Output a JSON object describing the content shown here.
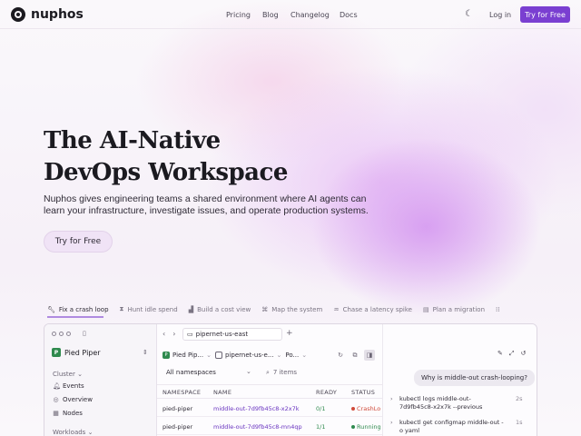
{
  "brand": {
    "name": "nuphos"
  },
  "nav": {
    "links": [
      "Pricing",
      "Blog",
      "Changelog",
      "Docs"
    ],
    "theme_icon": "moon-icon",
    "login": "Log in",
    "cta": "Try for Free"
  },
  "colors": {
    "accent": "#7a3fd1",
    "pod_link": "#6a35c0",
    "ready_green": "#2f8a4e",
    "crash_red": "#d04a3a"
  },
  "hero": {
    "title_line1": "The AI-Native",
    "title_line2": "DevOps Workspace",
    "subtitle": "Nuphos gives engineering teams a shared environment where AI agents can learn your infrastructure, investigate issues, and operate production systems.",
    "cta": "Try for Free"
  },
  "tabs": [
    {
      "label": "Fix a crash loop",
      "icon": "wrench-icon",
      "active": true
    },
    {
      "label": "Hunt idle spend",
      "icon": "hourglass-icon"
    },
    {
      "label": "Build a cost view",
      "icon": "chart-icon"
    },
    {
      "label": "Map the system",
      "icon": "map-icon"
    },
    {
      "label": "Chase a latency spike",
      "icon": "pulse-icon"
    },
    {
      "label": "Plan a migration",
      "icon": "clipboard-icon"
    }
  ],
  "app": {
    "sidebar": {
      "org": "Pied Piper",
      "org_badge": "P",
      "section_cluster": "Cluster",
      "items": [
        {
          "label": "Events",
          "icon": "bell-icon"
        },
        {
          "label": "Overview",
          "icon": "gauge-icon"
        },
        {
          "label": "Nodes",
          "icon": "server-icon"
        }
      ],
      "section_workloads": "Workloads"
    },
    "browser_tab": "pipernet-us-east",
    "crumbs": [
      "Pied Pip...",
      "pipernet-us-e...",
      "Po..."
    ],
    "filter": "All namespaces",
    "search": "7 items",
    "table": {
      "headers": [
        "NAMESPACE",
        "NAME",
        "READY",
        "STATUS"
      ],
      "rows": [
        {
          "namespace": "pied-piper",
          "name": "middle-out-7d9fb45c8-x2x7k",
          "ready": "0/1",
          "status": "CrashLo"
        },
        {
          "namespace": "pied-piper",
          "name": "middle-out-7d9fb45c8-mn4qp",
          "ready": "1/1",
          "status": "Running"
        }
      ]
    },
    "chat": {
      "question": "Why is middle-out crash-looping?",
      "commands": [
        {
          "text": "kubectl logs middle-out-7d9fb45c8-x2x7k --previous",
          "duration": "2s"
        },
        {
          "text": "kubectl get configmap middle-out -o yaml",
          "duration": "1s"
        }
      ]
    }
  }
}
